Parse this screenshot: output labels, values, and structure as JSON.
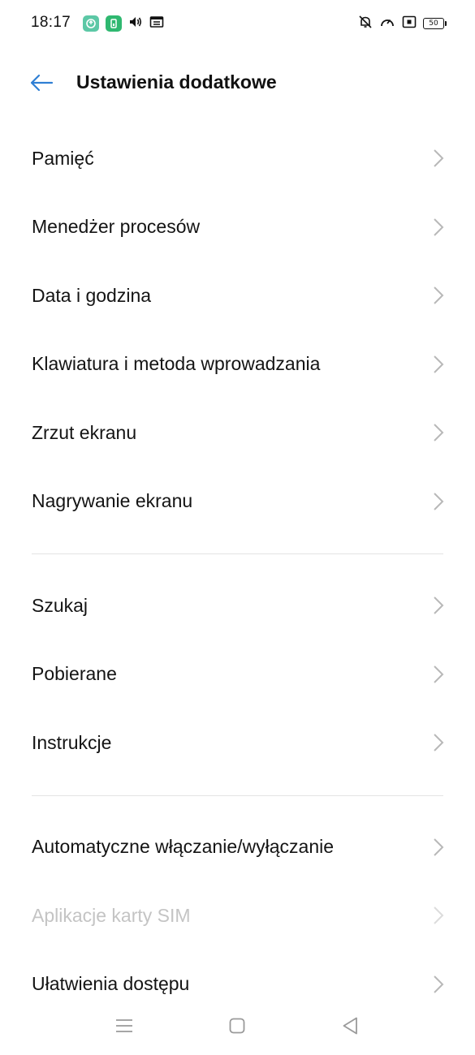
{
  "status_bar": {
    "time": "18:17",
    "battery_level": "50",
    "left_icons": [
      "app-badge-icon",
      "phone-badge-icon",
      "volume-icon",
      "screen-icon"
    ],
    "right_icons": [
      "bell-off-icon",
      "speed-icon",
      "nfc-icon",
      "battery-icon"
    ],
    "colors": {
      "badge_teal": "#5cc8a6",
      "badge_green": "#2fb870"
    }
  },
  "header": {
    "title": "Ustawienia dodatkowe",
    "back_icon": "arrow-left-icon",
    "accent_color": "#2f7fd4"
  },
  "sections": [
    {
      "items": [
        {
          "label": "Pamięć",
          "enabled": true
        },
        {
          "label": "Menedżer procesów",
          "enabled": true
        },
        {
          "label": "Data i godzina",
          "enabled": true
        },
        {
          "label": "Klawiatura i metoda wprowadzania",
          "enabled": true
        },
        {
          "label": "Zrzut ekranu",
          "enabled": true
        },
        {
          "label": "Nagrywanie ekranu",
          "enabled": true
        }
      ]
    },
    {
      "items": [
        {
          "label": "Szukaj",
          "enabled": true
        },
        {
          "label": "Pobierane",
          "enabled": true
        },
        {
          "label": "Instrukcje",
          "enabled": true
        }
      ]
    },
    {
      "items": [
        {
          "label": "Automatyczne włączanie/wyłączanie",
          "enabled": true
        },
        {
          "label": "Aplikacje karty SIM",
          "enabled": false
        },
        {
          "label": "Ułatwienia dostępu",
          "enabled": true
        }
      ]
    }
  ],
  "nav_bar": {
    "icons": [
      "menu-icon",
      "home-icon",
      "back-triangle-icon"
    ]
  }
}
